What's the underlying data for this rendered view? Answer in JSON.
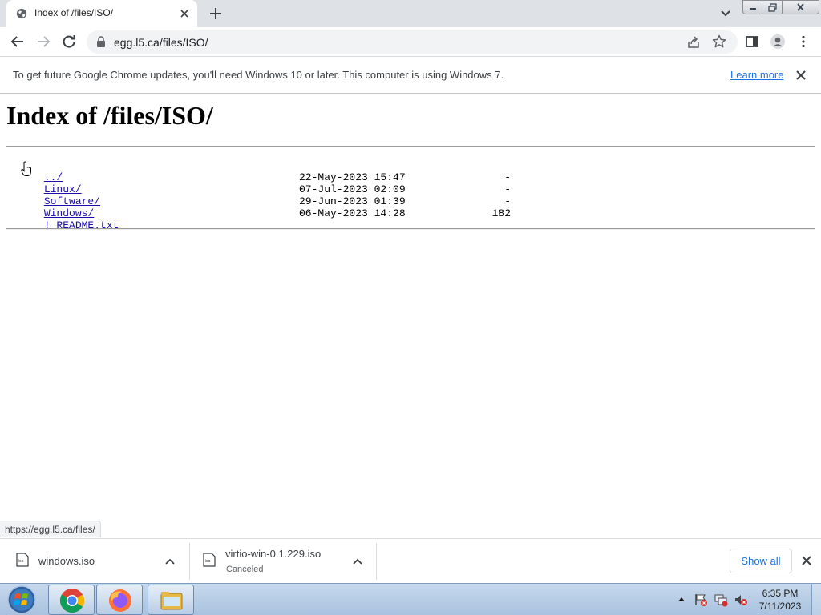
{
  "browser": {
    "tab": {
      "title": "Index of /files/ISO/",
      "favicon": "globe-icon"
    },
    "address": {
      "url": "egg.l5.ca/files/ISO/"
    }
  },
  "infobar": {
    "message": "To get future Google Chrome updates, you'll need Windows 10 or later. This computer is using Windows 7.",
    "link_label": "Learn more"
  },
  "page": {
    "heading": "Index of /files/ISO/",
    "entries": [
      {
        "name": "../",
        "date": "",
        "size": ""
      },
      {
        "name": "Linux/",
        "date": "22-May-2023 15:47",
        "size": "-"
      },
      {
        "name": "Software/",
        "date": "07-Jul-2023 02:09",
        "size": "-"
      },
      {
        "name": "Windows/",
        "date": "29-Jun-2023 01:39",
        "size": "-"
      },
      {
        "name": "! README.txt",
        "date": "06-May-2023 14:28",
        "size": "182"
      }
    ]
  },
  "status_bar": {
    "url": "https://egg.l5.ca/files/"
  },
  "downloads": {
    "items": [
      {
        "name": "windows.iso",
        "status": ""
      },
      {
        "name": "virtio-win-0.1.229.iso",
        "status": "Canceled"
      }
    ],
    "show_all_label": "Show all"
  },
  "taskbar": {
    "apps": [
      "chrome-icon",
      "firefox-icon",
      "file-explorer-icon"
    ],
    "clock": {
      "time": "6:35 PM",
      "date": "7/11/2023"
    }
  },
  "colors": {
    "link": "#1a0dab",
    "accent": "#1a73e8",
    "tabstrip": "#dee1e6",
    "taskbar": "#b5cbe5"
  }
}
